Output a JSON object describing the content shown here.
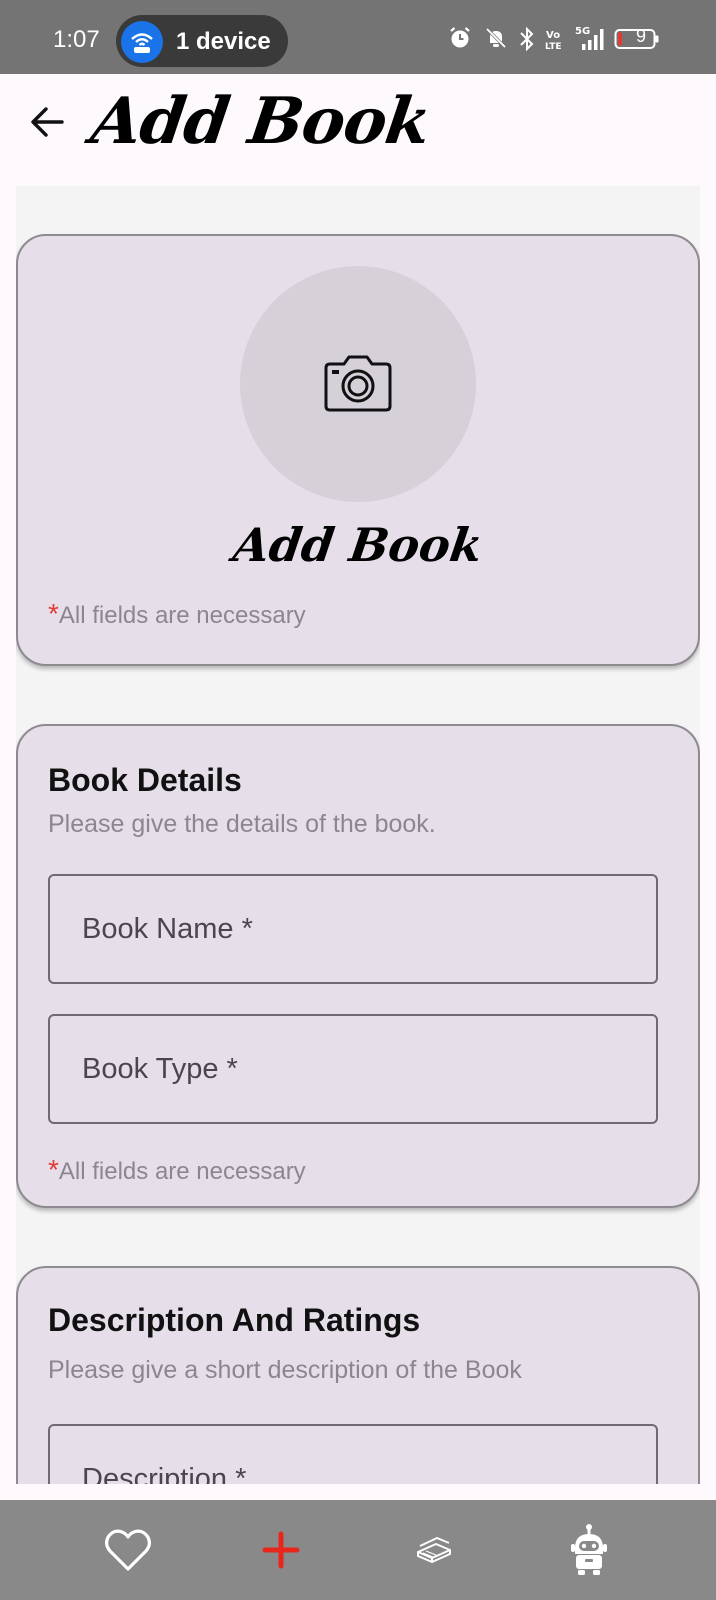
{
  "status_bar": {
    "time": "1:07",
    "hotspot_label": "1 device",
    "battery_level": "9",
    "icons": [
      "wifi-hotspot-icon",
      "alarm-icon",
      "mute-icon",
      "bluetooth-icon",
      "volte-icon",
      "5g-signal-icon",
      "battery-icon"
    ]
  },
  "app_bar": {
    "title": "Add Book",
    "back_icon": "arrow-back-icon"
  },
  "photo_card": {
    "icon": "camera-icon",
    "title": "Add Book",
    "required_star": "*",
    "required_note": "All fields are necessary"
  },
  "book_details": {
    "title": "Book Details",
    "subtitle": "Please give the details of the book.",
    "fields": [
      {
        "placeholder": "Book Name *",
        "value": ""
      },
      {
        "placeholder": "Book Type *",
        "value": ""
      }
    ],
    "required_star": "*",
    "required_note": "All fields are necessary"
  },
  "description": {
    "title": "Description And Ratings",
    "subtitle": "Please give a short description of the Book",
    "fields": [
      {
        "placeholder": "Description *",
        "value": ""
      }
    ]
  },
  "bottom_nav": {
    "items": [
      {
        "icon": "heart-icon",
        "color": "#ffffff"
      },
      {
        "icon": "plus-icon",
        "color": "#e8261c"
      },
      {
        "icon": "books-icon",
        "color": "#ffffff"
      },
      {
        "icon": "robot-icon",
        "color": "#ffffff"
      }
    ]
  },
  "colors": {
    "status_bar": "#747474",
    "hotspot_blue": "#1a73e8",
    "card_bg": "#e6dfea",
    "nav_bg": "#898989",
    "required_red": "#e53935",
    "add_red": "#e8261c"
  }
}
